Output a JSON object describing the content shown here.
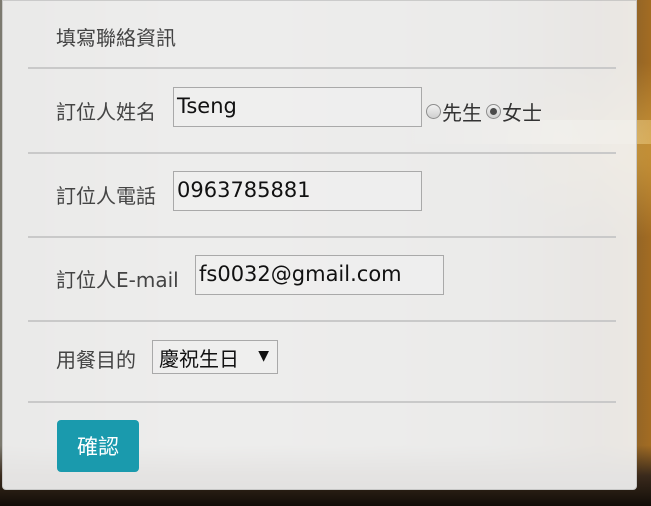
{
  "form": {
    "title": "填寫聯絡資訊",
    "name": {
      "label": "訂位人姓名",
      "value": "Tseng",
      "options": [
        {
          "label": "先生",
          "checked": false
        },
        {
          "label": "女士",
          "checked": true
        }
      ]
    },
    "phone": {
      "label": "訂位人電話",
      "value": "0963785881"
    },
    "email": {
      "label": "訂位人E-mail",
      "value": "fs0032@gmail.com"
    },
    "purpose": {
      "label": "用餐目的",
      "selected": "慶祝生日"
    },
    "submit_label": "確認"
  },
  "colors": {
    "accent": "#1a9aad"
  }
}
